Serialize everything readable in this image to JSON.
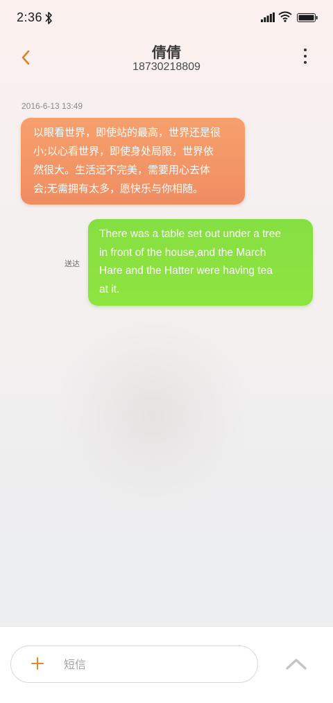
{
  "status_bar": {
    "time": "2:36",
    "icons": [
      "bluetooth-icon",
      "signal-icon",
      "wifi-icon",
      "battery-icon"
    ]
  },
  "header": {
    "contact_name": "倩倩",
    "contact_number": "18730218809",
    "back_icon": "chevron-left-icon",
    "more_icon": "more-vertical-icon"
  },
  "conversation": {
    "timestamp": "2016-6-13 13:49",
    "incoming_message": {
      "lines": [
        "以眼看世界，即使站的最高，世界还是很",
        "小;以心看世界，即使身处局限，世界依",
        "然很大。生活远不完美，需要用心去体",
        "会;无需拥有太多，愿快乐与你相随。"
      ]
    },
    "outgoing_message": {
      "lines": [
        "There was a table set out under a tree",
        "in front of the house,and the March",
        "Hare and the Hatter were having tea",
        "at it."
      ],
      "status": "送达"
    }
  },
  "composer": {
    "placeholder": "短信",
    "add_icon": "plus-icon",
    "send_icon": "chevron-up-icon"
  },
  "colors": {
    "accent": "#e08a2e",
    "incoming_bubble": "#f39767",
    "outgoing_bubble": "#8ae241"
  }
}
